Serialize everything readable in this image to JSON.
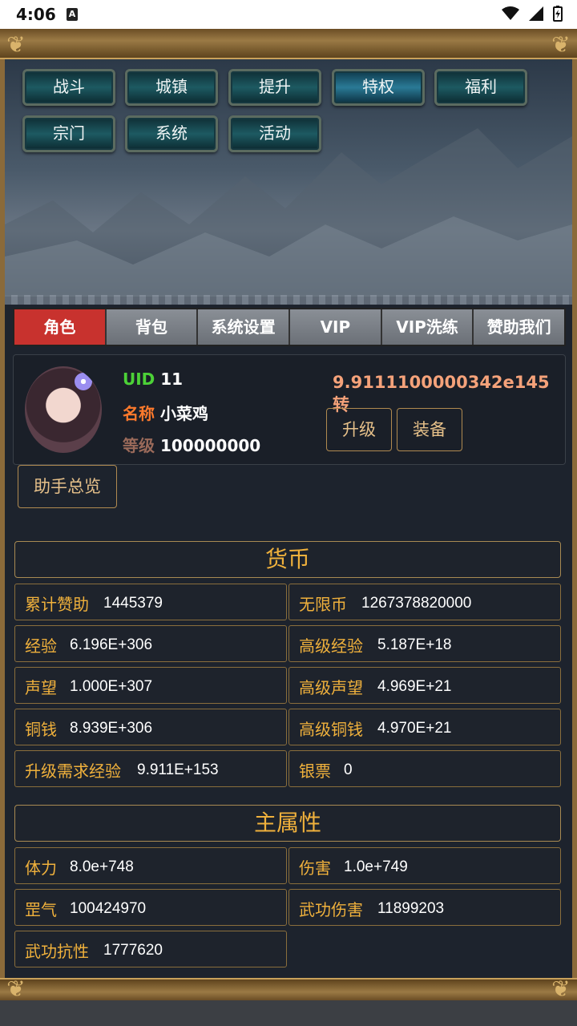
{
  "status": {
    "time": "4:06",
    "a_icon": "A"
  },
  "top_menu": [
    {
      "label": "战斗"
    },
    {
      "label": "城镇"
    },
    {
      "label": "提升"
    },
    {
      "label": "特权"
    },
    {
      "label": "福利"
    },
    {
      "label": "宗门"
    },
    {
      "label": "系统"
    },
    {
      "label": "活动"
    }
  ],
  "tabs": [
    {
      "label": "角色"
    },
    {
      "label": "背包"
    },
    {
      "label": "系统设置"
    },
    {
      "label": "VIP"
    },
    {
      "label": "VIP洗练"
    },
    {
      "label": "赞助我们"
    }
  ],
  "profile": {
    "uid_label": "UID",
    "uid_value": "11",
    "name_label": "名称",
    "name_value": "小菜鸡",
    "level_label": "等级",
    "level_value": "100000000",
    "zhuan": "9.9111100000342e145转",
    "upgrade_btn": "升级",
    "equip_btn": "装备"
  },
  "assistant_btn": "助手总览",
  "currency": {
    "title": "货币",
    "items": [
      {
        "k": "累计赞助",
        "v": "1445379"
      },
      {
        "k": "无限币",
        "v": "1267378820000"
      },
      {
        "k": "经验",
        "v": "6.196E+306"
      },
      {
        "k": "高级经验",
        "v": "5.187E+18"
      },
      {
        "k": "声望",
        "v": "1.000E+307"
      },
      {
        "k": "高级声望",
        "v": "4.969E+21"
      },
      {
        "k": "铜钱",
        "v": "8.939E+306"
      },
      {
        "k": "高级铜钱",
        "v": "4.970E+21"
      },
      {
        "k": "升级需求经验",
        "v": "9.911E+153"
      },
      {
        "k": "银票",
        "v": "0"
      }
    ]
  },
  "attributes": {
    "title": "主属性",
    "items": [
      {
        "k": "体力",
        "v": "8.0e+748"
      },
      {
        "k": "伤害",
        "v": "1.0e+749"
      },
      {
        "k": "罡气",
        "v": "100424970"
      },
      {
        "k": "武功伤害",
        "v": "11899203"
      },
      {
        "k": "武功抗性",
        "v": "1777620"
      }
    ]
  }
}
